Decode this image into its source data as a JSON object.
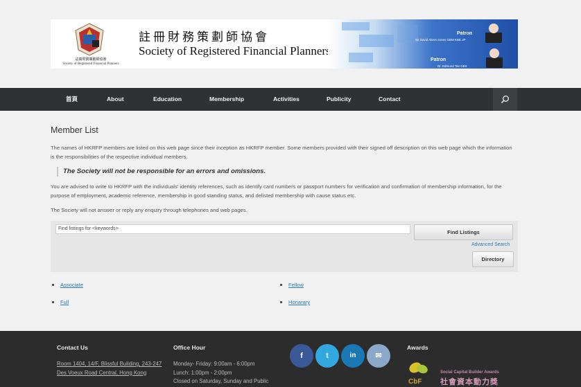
{
  "banner": {
    "title_cn": "註冊財務策劃師協會",
    "title_en": "Society of Registered Financial Planners",
    "logo_caption_cn": "註冊財務策劃師協會",
    "logo_caption_en": "Society of Registered Financial Planners",
    "patron1_label": "Patron",
    "patron1_name": "Sir David Akers-Jones GBM KBE JP",
    "patron2_label": "Patron",
    "patron2_name": "Dr. Edmund Tse GBS"
  },
  "nav": {
    "items": [
      {
        "label": "首頁"
      },
      {
        "label": "About"
      },
      {
        "label": "Education"
      },
      {
        "label": "Membership"
      },
      {
        "label": "Activities"
      },
      {
        "label": "Publicity"
      },
      {
        "label": "Contact"
      }
    ],
    "search_icon": "search-icon"
  },
  "page": {
    "title": "Member List",
    "intro": "The names of HKRFP members are listed on this web page since their inception as HKRFP member. Some members provided with their signed off description on this web page which the information is the responsibilities of the respective individual members.",
    "disclaimer": "The Society will not be responsible for an errors and omissions.",
    "advice": "You are advised to write to HKRFP with the individuals' identity references, such as identify card numbers or passport numbers for verification and confirmation of membership information, for the purpose of employment, academic reference, membership in good standing status, and delisted membership with cause status etc.",
    "no_reply": "The Society will not answer or reply any enquiry through telephones and web pages."
  },
  "search": {
    "value": "Find listings for <keywords>",
    "find_label": "Find Listings",
    "advanced_label": "Advanced Search",
    "directory_label": "Directory"
  },
  "categories": [
    {
      "label": "Associate"
    },
    {
      "label": "Fellow"
    },
    {
      "label": "Full"
    },
    {
      "label": "Honarary"
    }
  ],
  "footer": {
    "contact_heading": "Contact Us",
    "address": "Room 1404, 14/F, Blissful Building, 243-247 Des Voeux Road Central, Hong Kong",
    "office_heading": "Office Hour",
    "hours_line1": "Monday- Friday: 9:00am - 6:00pm",
    "hours_line2": "Lunch: 1:00pm - 2:00pm",
    "hours_line3": "Closed on Saturday, Sunday and Public",
    "awards_heading": "Awards",
    "award_en": "Social Capital Builder Awards",
    "award_cn": "社會資本動力獎",
    "social": [
      {
        "icon": "facebook-icon",
        "glyph": "f",
        "color": "#3b5998"
      },
      {
        "icon": "twitter-icon",
        "glyph": "t",
        "color": "#33a8e0"
      },
      {
        "icon": "linkedin-icon",
        "glyph": "in",
        "color": "#1a78b4"
      },
      {
        "icon": "email-icon",
        "glyph": "✉",
        "color": "#8aa9c9"
      }
    ]
  }
}
